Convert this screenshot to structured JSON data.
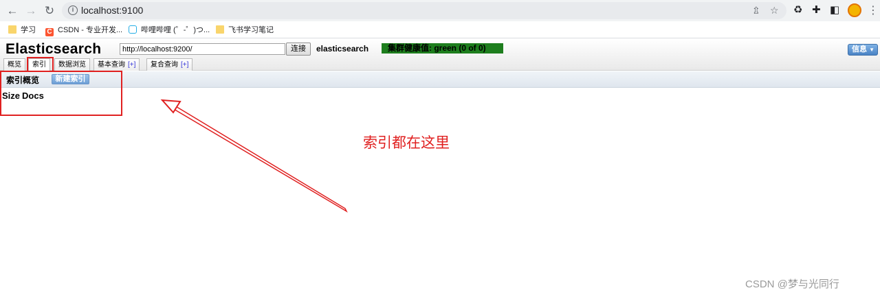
{
  "browser": {
    "url": "localhost:9100",
    "nav_icons": [
      "back-icon",
      "forward-icon",
      "reload-icon"
    ],
    "bookmarks": [
      {
        "label": "学习",
        "icon": "folder-icon"
      },
      {
        "label": "CSDN - 专业开发...",
        "icon": "csdn-icon",
        "icon_text": "C"
      },
      {
        "label": "哔哩哔哩 (゜-゜)つ...",
        "icon": "bilibili-icon"
      },
      {
        "label": "飞书学习笔记",
        "icon": "folder-icon"
      }
    ]
  },
  "app": {
    "title": "Elasticsearch",
    "connect_url": "http://localhost:9200/",
    "connect_label": "连接",
    "cluster_name": "elasticsearch",
    "health_text": "集群健康值: green (0 of 0)",
    "health_color": "#1e7e1e",
    "info_label": "信息",
    "tabs": [
      {
        "label": "概览",
        "plus": ""
      },
      {
        "label": "索引",
        "plus": ""
      },
      {
        "label": "数据浏览",
        "plus": ""
      },
      {
        "label": "基本查询",
        "plus": "[+]"
      },
      {
        "label": "复合查询",
        "plus": "[+]"
      }
    ],
    "active_tab": "索引",
    "section_title": "索引概览",
    "new_index_label": "新建索引",
    "columns": [
      "Size",
      "Docs"
    ]
  },
  "annotation": {
    "text": "索引都在这里",
    "color": "#e02020"
  },
  "watermark": "CSDN @梦与光同行"
}
